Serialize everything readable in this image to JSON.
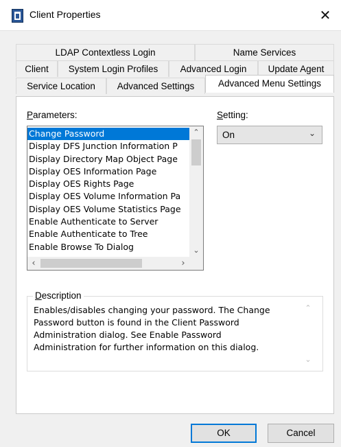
{
  "window": {
    "title": "Client Properties",
    "close_glyph": "✕"
  },
  "tabs": {
    "row1": [
      {
        "label": "LDAP Contextless Login"
      },
      {
        "label": "Name Services"
      }
    ],
    "row2": [
      {
        "label": "Client"
      },
      {
        "label": "System Login Profiles"
      },
      {
        "label": "Advanced Login"
      },
      {
        "label": "Update Agent"
      }
    ],
    "row3": [
      {
        "label": "Service Location"
      },
      {
        "label": "Advanced Settings"
      },
      {
        "label": "Advanced Menu Settings",
        "active": true
      }
    ]
  },
  "parameters": {
    "label_ul": "P",
    "label_rest": "arameters:",
    "items": [
      "Change Password",
      "Display DFS Junction Information P",
      "Display Directory Map Object Page",
      "Display OES Information Page",
      "Display OES Rights Page",
      "Display OES Volume Information Pa",
      "Display OES Volume Statistics Page",
      "Enable Authenticate to Server",
      "Enable Authenticate to Tree",
      "Enable Browse To Dialog"
    ],
    "selected_index": 0
  },
  "setting": {
    "label_ul": "S",
    "label_rest": "etting:",
    "value": "On"
  },
  "description": {
    "title_ul": "D",
    "title_rest": "escription",
    "text": "Enables/disables changing your password. The Change\nPassword button is found in the Client Password\nAdministration dialog.  See Enable Password\nAdministration for further information on this dialog."
  },
  "buttons": {
    "ok": "OK",
    "cancel": "Cancel"
  },
  "colors": {
    "selection": "#0078d7",
    "app_icon": "#2b5797"
  },
  "icons": {
    "app": "client-properties-app-icon",
    "close": "close-icon"
  }
}
